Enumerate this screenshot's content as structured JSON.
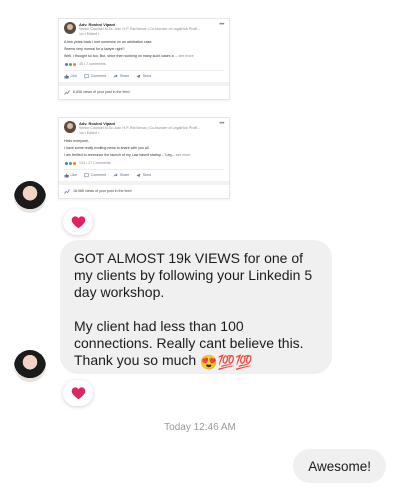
{
  "post1": {
    "name": "Adv. Roshni Vipani",
    "subtitle": "Senior Counsel M.Sc. Adv. H.P. Rai Nexus | Co-founder of LegalHub Profil...",
    "time": "1w • Edited •",
    "lines": [
      "A few years back I met someone on an arbitration case.",
      "Seems very normal for a lawyer right?",
      "Well, I thought so too. But, since then working on many such cases a ..."
    ],
    "see_more": "see more",
    "reactions_count": "35 • 7 comments",
    "actions": [
      "Like",
      "Comment",
      "Share",
      "Send"
    ],
    "views": "6,836 views of your post in the feed"
  },
  "post2": {
    "name": "Adv. Roshni Vipani",
    "subtitle": "Senior Counsel M.Sc. Adv. H.P. Rai Nexus | Co-founder of LegalHub Profil...",
    "time": "1w • Edited •",
    "lines": [
      "Hello everyone,",
      "I have some really exciting news to share with you all.",
      "I am thrilled to announce the launch of my Law based startup - \"Leg..."
    ],
    "see_more": "see more",
    "reactions_count": "134 • 27 Comments",
    "actions": [
      "Like",
      "Comment",
      "Share",
      "Send"
    ],
    "views": "18,966 views of your post in the feed"
  },
  "message": {
    "paragraph1": "GOT ALMOST 19k VIEWS for one of my clients by following your Linkedin 5 day workshop.",
    "paragraph2": "My client had less than 100 connections. Really cant believe this. Thank you so much",
    "emoji1": "😍",
    "emoji2": "💯",
    "emoji3": "💯"
  },
  "timestamp": "Today 12:46 AM",
  "reply": "Awesome!",
  "colors": {
    "heart": "#e0245e",
    "bubble": "#f0f0f0",
    "timestamp": "#9a9a9a"
  }
}
